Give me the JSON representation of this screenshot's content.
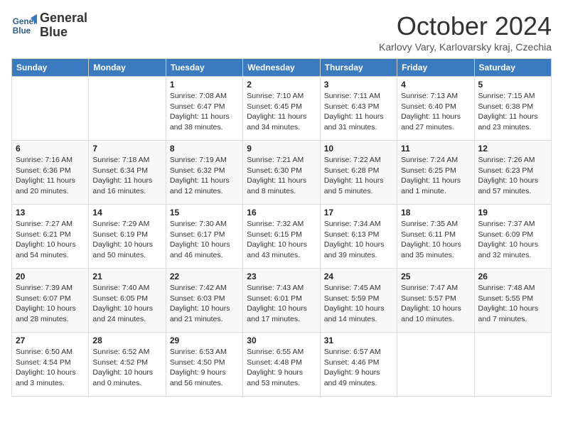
{
  "header": {
    "logo_line1": "General",
    "logo_line2": "Blue",
    "month": "October 2024",
    "location": "Karlovy Vary, Karlovarsky kraj, Czechia"
  },
  "weekdays": [
    "Sunday",
    "Monday",
    "Tuesday",
    "Wednesday",
    "Thursday",
    "Friday",
    "Saturday"
  ],
  "weeks": [
    [
      {
        "day": "",
        "info": ""
      },
      {
        "day": "",
        "info": ""
      },
      {
        "day": "1",
        "info": "Sunrise: 7:08 AM\nSunset: 6:47 PM\nDaylight: 11 hours and 38 minutes."
      },
      {
        "day": "2",
        "info": "Sunrise: 7:10 AM\nSunset: 6:45 PM\nDaylight: 11 hours and 34 minutes."
      },
      {
        "day": "3",
        "info": "Sunrise: 7:11 AM\nSunset: 6:43 PM\nDaylight: 11 hours and 31 minutes."
      },
      {
        "day": "4",
        "info": "Sunrise: 7:13 AM\nSunset: 6:40 PM\nDaylight: 11 hours and 27 minutes."
      },
      {
        "day": "5",
        "info": "Sunrise: 7:15 AM\nSunset: 6:38 PM\nDaylight: 11 hours and 23 minutes."
      }
    ],
    [
      {
        "day": "6",
        "info": "Sunrise: 7:16 AM\nSunset: 6:36 PM\nDaylight: 11 hours and 20 minutes."
      },
      {
        "day": "7",
        "info": "Sunrise: 7:18 AM\nSunset: 6:34 PM\nDaylight: 11 hours and 16 minutes."
      },
      {
        "day": "8",
        "info": "Sunrise: 7:19 AM\nSunset: 6:32 PM\nDaylight: 11 hours and 12 minutes."
      },
      {
        "day": "9",
        "info": "Sunrise: 7:21 AM\nSunset: 6:30 PM\nDaylight: 11 hours and 8 minutes."
      },
      {
        "day": "10",
        "info": "Sunrise: 7:22 AM\nSunset: 6:28 PM\nDaylight: 11 hours and 5 minutes."
      },
      {
        "day": "11",
        "info": "Sunrise: 7:24 AM\nSunset: 6:25 PM\nDaylight: 11 hours and 1 minute."
      },
      {
        "day": "12",
        "info": "Sunrise: 7:26 AM\nSunset: 6:23 PM\nDaylight: 10 hours and 57 minutes."
      }
    ],
    [
      {
        "day": "13",
        "info": "Sunrise: 7:27 AM\nSunset: 6:21 PM\nDaylight: 10 hours and 54 minutes."
      },
      {
        "day": "14",
        "info": "Sunrise: 7:29 AM\nSunset: 6:19 PM\nDaylight: 10 hours and 50 minutes."
      },
      {
        "day": "15",
        "info": "Sunrise: 7:30 AM\nSunset: 6:17 PM\nDaylight: 10 hours and 46 minutes."
      },
      {
        "day": "16",
        "info": "Sunrise: 7:32 AM\nSunset: 6:15 PM\nDaylight: 10 hours and 43 minutes."
      },
      {
        "day": "17",
        "info": "Sunrise: 7:34 AM\nSunset: 6:13 PM\nDaylight: 10 hours and 39 minutes."
      },
      {
        "day": "18",
        "info": "Sunrise: 7:35 AM\nSunset: 6:11 PM\nDaylight: 10 hours and 35 minutes."
      },
      {
        "day": "19",
        "info": "Sunrise: 7:37 AM\nSunset: 6:09 PM\nDaylight: 10 hours and 32 minutes."
      }
    ],
    [
      {
        "day": "20",
        "info": "Sunrise: 7:39 AM\nSunset: 6:07 PM\nDaylight: 10 hours and 28 minutes."
      },
      {
        "day": "21",
        "info": "Sunrise: 7:40 AM\nSunset: 6:05 PM\nDaylight: 10 hours and 24 minutes."
      },
      {
        "day": "22",
        "info": "Sunrise: 7:42 AM\nSunset: 6:03 PM\nDaylight: 10 hours and 21 minutes."
      },
      {
        "day": "23",
        "info": "Sunrise: 7:43 AM\nSunset: 6:01 PM\nDaylight: 10 hours and 17 minutes."
      },
      {
        "day": "24",
        "info": "Sunrise: 7:45 AM\nSunset: 5:59 PM\nDaylight: 10 hours and 14 minutes."
      },
      {
        "day": "25",
        "info": "Sunrise: 7:47 AM\nSunset: 5:57 PM\nDaylight: 10 hours and 10 minutes."
      },
      {
        "day": "26",
        "info": "Sunrise: 7:48 AM\nSunset: 5:55 PM\nDaylight: 10 hours and 7 minutes."
      }
    ],
    [
      {
        "day": "27",
        "info": "Sunrise: 6:50 AM\nSunset: 4:54 PM\nDaylight: 10 hours and 3 minutes."
      },
      {
        "day": "28",
        "info": "Sunrise: 6:52 AM\nSunset: 4:52 PM\nDaylight: 10 hours and 0 minutes."
      },
      {
        "day": "29",
        "info": "Sunrise: 6:53 AM\nSunset: 4:50 PM\nDaylight: 9 hours and 56 minutes."
      },
      {
        "day": "30",
        "info": "Sunrise: 6:55 AM\nSunset: 4:48 PM\nDaylight: 9 hours and 53 minutes."
      },
      {
        "day": "31",
        "info": "Sunrise: 6:57 AM\nSunset: 4:46 PM\nDaylight: 9 hours and 49 minutes."
      },
      {
        "day": "",
        "info": ""
      },
      {
        "day": "",
        "info": ""
      }
    ]
  ]
}
